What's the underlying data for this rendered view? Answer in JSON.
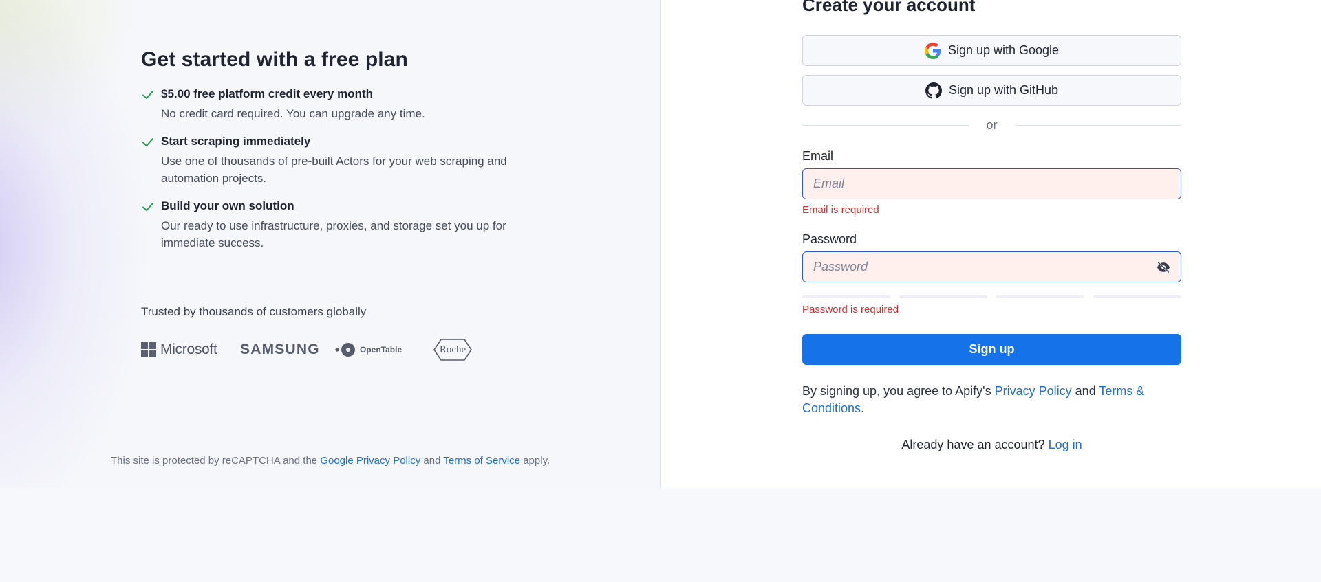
{
  "promo": {
    "title": "Get started with a free plan",
    "benefits": [
      {
        "title": "$5.00 free platform credit every month",
        "desc": "No credit card required. You can upgrade any time."
      },
      {
        "title": "Start scraping immediately",
        "desc": "Use one of thousands of pre-built Actors for your web scraping and automation projects."
      },
      {
        "title": "Build your own solution",
        "desc": "Our ready to use infrastructure, proxies, and storage set you up for immediate success."
      }
    ],
    "trusted_text": "Trusted by thousands of customers globally",
    "logos": {
      "microsoft": "Microsoft",
      "samsung": "SAMSUNG",
      "opentable": "OpenTable",
      "roche": "Roche"
    }
  },
  "recaptcha": {
    "prefix": "This site is protected by reCAPTCHA and the",
    "privacy_link": "Google Privacy Policy",
    "and": "and",
    "terms_link": "Terms of Service",
    "suffix": "apply."
  },
  "form": {
    "title": "Create your account",
    "google_button": "Sign up with Google",
    "github_button": "Sign up with GitHub",
    "divider_text": "or",
    "email": {
      "label": "Email",
      "placeholder": "Email",
      "value": "",
      "error": "Email is required"
    },
    "password": {
      "label": "Password",
      "placeholder": "Password",
      "value": "",
      "error": "Password is required"
    },
    "submit_label": "Sign up",
    "agree": {
      "prefix": "By signing up, you agree to Apify's",
      "privacy_link": "Privacy Policy",
      "and": "and",
      "terms_link": "Terms & Conditions",
      "suffix": "."
    },
    "login": {
      "prompt": "Already have an account?",
      "link": "Log in"
    }
  },
  "colors": {
    "accent": "#1672e8",
    "link": "#1c6ed6",
    "error": "#d0302f",
    "check": "#1f9e4a",
    "input_error_bg": "#fff0ee"
  },
  "icons": [
    "check-icon",
    "google-icon",
    "github-icon",
    "eye-off-icon",
    "microsoft-logo",
    "samsung-logo",
    "opentable-logo",
    "roche-logo"
  ]
}
